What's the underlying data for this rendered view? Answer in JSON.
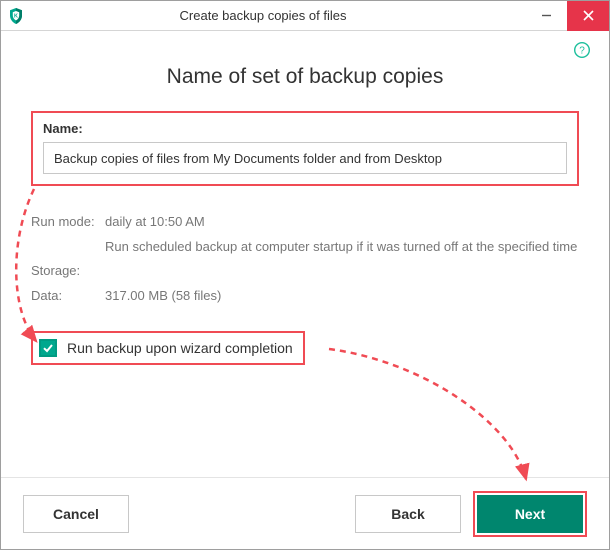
{
  "titlebar": {
    "title": "Create backup copies of files"
  },
  "heading": "Name of set of backup copies",
  "name_section": {
    "label": "Name:",
    "value": "Backup copies of files from My Documents folder and from Desktop"
  },
  "info": {
    "run_mode_label": "Run mode:",
    "run_mode_value": "daily at 10:50 AM",
    "run_mode_note": "Run scheduled backup at computer startup if it was turned off at the specified time",
    "storage_label": "Storage:",
    "storage_value": "",
    "data_label": "Data:",
    "data_value": "317.00 MB (58 files)"
  },
  "checkbox": {
    "label": "Run backup upon wizard completion",
    "checked": true
  },
  "footer": {
    "cancel": "Cancel",
    "back": "Back",
    "next": "Next"
  }
}
